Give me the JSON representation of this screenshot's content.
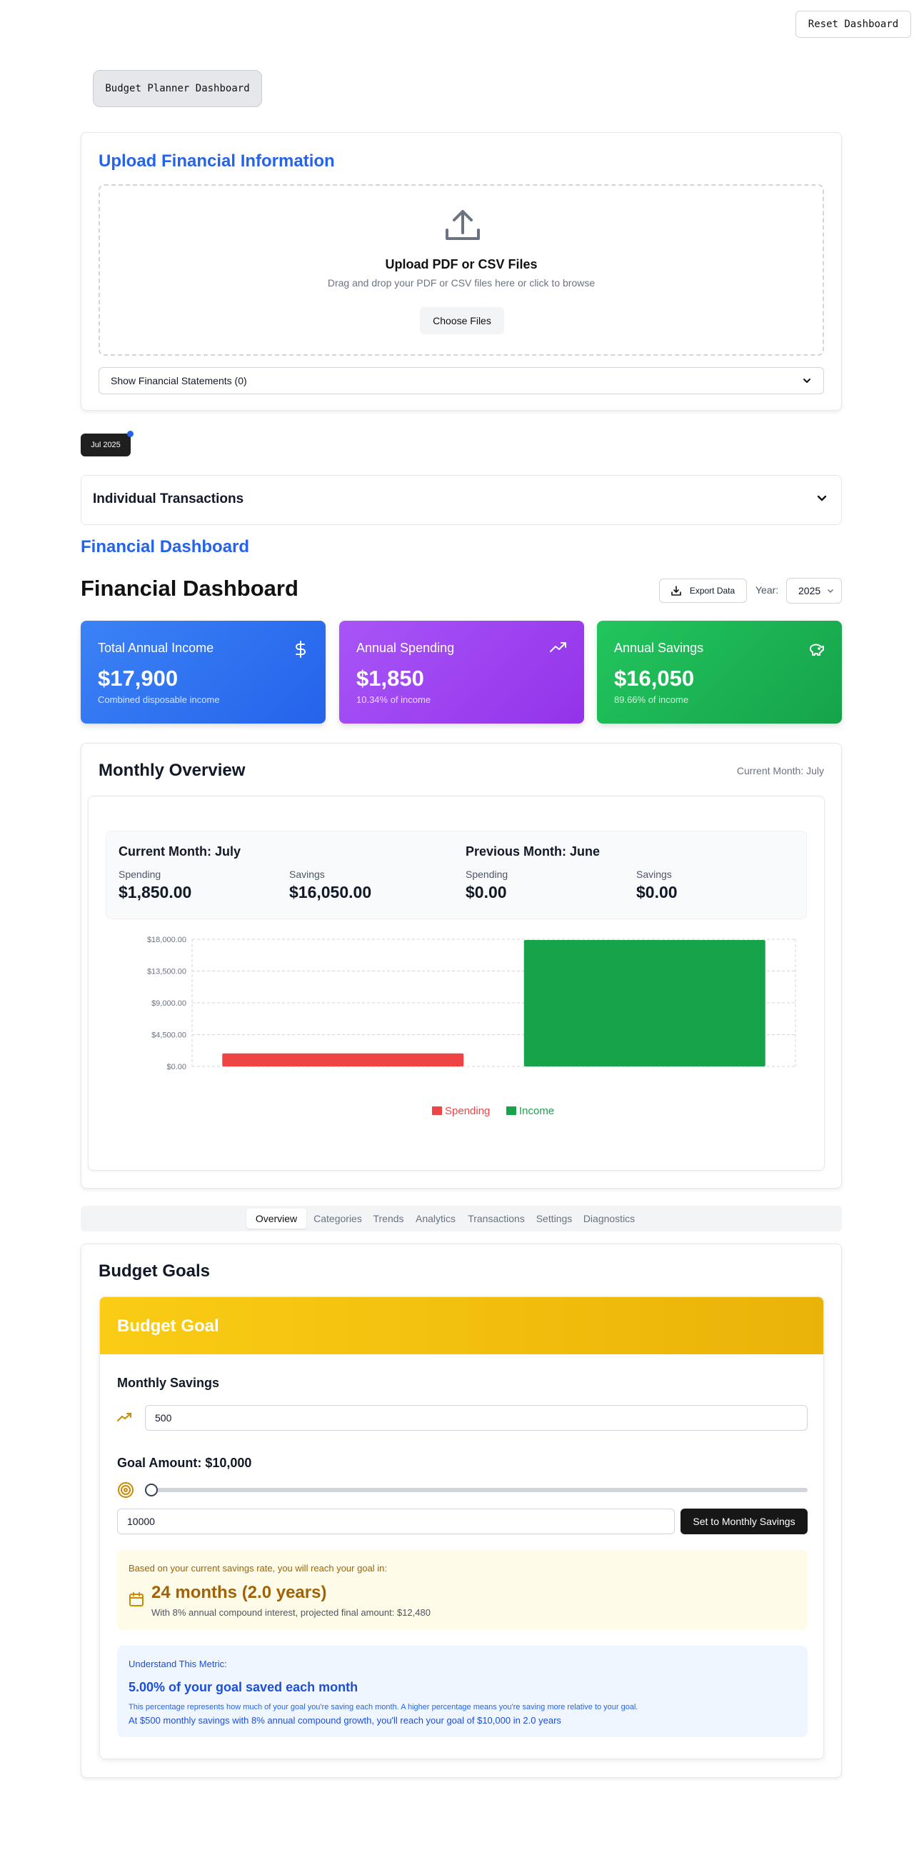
{
  "top": {
    "reset_label": "Reset Dashboard",
    "app_title": "Budget Planner Dashboard"
  },
  "upload": {
    "title": "Upload Financial Information",
    "drop_title": "Upload PDF or CSV Files",
    "drop_subtitle": "Drag and drop your PDF or CSV files here or click to browse",
    "choose_label": "Choose Files",
    "statements_toggle": "Show Financial Statements (0)",
    "icon": "upload-icon"
  },
  "month_chip": "Jul 2025",
  "transactions": {
    "title": "Individual Transactions"
  },
  "dashboard": {
    "section_label": "Financial Dashboard",
    "heading": "Financial Dashboard",
    "export_label": "Export Data",
    "year_label": "Year:",
    "year_value": "2025"
  },
  "stats": [
    {
      "label": "Total Annual Income",
      "value": "$17,900",
      "sub": "Combined disposable income",
      "icon": "dollar-icon",
      "color": "#3b82f6"
    },
    {
      "label": "Annual Spending",
      "value": "$1,850",
      "sub": "10.34% of income",
      "icon": "trending-up-icon",
      "color": "#a855f7"
    },
    {
      "label": "Annual Savings",
      "value": "$16,050",
      "sub": "89.66% of income",
      "icon": "piggy-bank-icon",
      "color": "#22c55e"
    }
  ],
  "overview": {
    "title": "Monthly Overview",
    "current_label": "Current Month: July",
    "current": {
      "heading": "Current Month: July",
      "spending_label": "Spending",
      "spending_value": "$1,850.00",
      "savings_label": "Savings",
      "savings_value": "$16,050.00"
    },
    "previous": {
      "heading": "Previous Month: June",
      "spending_label": "Spending",
      "spending_value": "$0.00",
      "savings_label": "Savings",
      "savings_value": "$0.00"
    }
  },
  "chart_data": {
    "type": "bar",
    "categories": [
      "Spending",
      "Income"
    ],
    "values": [
      1850,
      17900
    ],
    "colors": [
      "#ef4444",
      "#16a34a"
    ],
    "yticks": [
      "$0.00",
      "$4,500.00",
      "$9,000.00",
      "$13,500.00",
      "$18,000.00"
    ],
    "ylim": [
      0,
      18000
    ],
    "legend": [
      "Spending",
      "Income"
    ],
    "legend_position": "bottom",
    "grid": true
  },
  "tabs": [
    "Overview",
    "Categories",
    "Trends",
    "Analytics",
    "Transactions",
    "Settings",
    "Diagnostics"
  ],
  "active_tab": "Overview",
  "goals": {
    "title": "Budget Goals",
    "header": "Budget Goal",
    "monthly_savings_label": "Monthly Savings",
    "monthly_savings_value": "500",
    "goal_amount_label": "Goal Amount: $10,000",
    "goal_amount_value": "10000",
    "slider_fraction": 0.0,
    "set_button": "Set to Monthly Savings",
    "projection_intro": "Based on your current savings rate, you will reach your goal in:",
    "projection_value": "24 months (2.0 years)",
    "projection_note": "With 8% annual compound interest, projected final amount: $12,480",
    "metric_heading": "Understand This Metric:",
    "metric_value": "5.00% of your goal saved each month",
    "metric_explanation": "This percentage represents how much of your goal you're saving each month. A higher percentage means you're saving more relative to your goal.",
    "metric_detail": "At $500 monthly savings with 8% annual compound growth, you'll reach your goal of $10,000 in 2.0 years"
  }
}
